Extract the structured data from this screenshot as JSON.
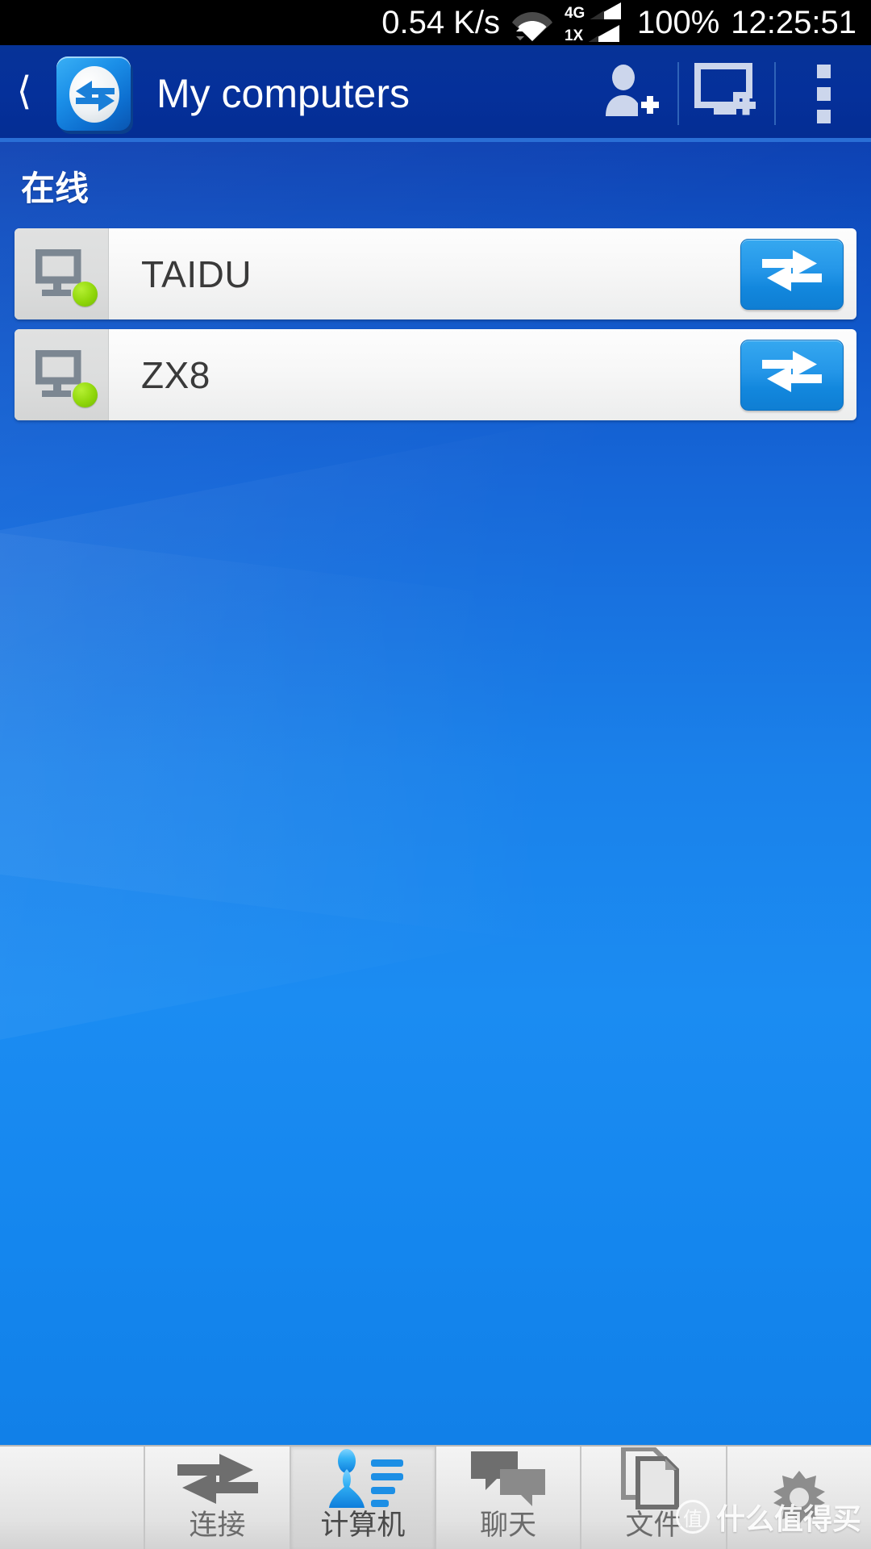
{
  "status_bar": {
    "network_speed": "0.54 K/s",
    "wifi_icon": "wifi-icon",
    "sim1_label": "4G",
    "sim2_label": "1X",
    "battery": "100%",
    "clock": "12:25:51",
    "background_color": "#000000",
    "text_color": "#ffffff"
  },
  "app_bar": {
    "back_icon": "back-chevron-icon",
    "logo_icon": "teamviewer-logo-icon",
    "title": "My computers",
    "actions": [
      {
        "name": "add-contact-button",
        "icon": "person-add-icon"
      },
      {
        "name": "add-computer-button",
        "icon": "monitor-add-icon"
      },
      {
        "name": "overflow-menu-button",
        "icon": "kebab-menu-icon"
      }
    ],
    "background_color": "#05309a",
    "title_color": "#ffffff"
  },
  "content": {
    "section_title": "在线",
    "background_color": "#1a81ea",
    "computers": [
      {
        "name": "TAIDU",
        "status": "online",
        "status_color": "#8fd60a",
        "device_icon": "monitor-icon",
        "connect_icon": "connect-arrows-icon"
      },
      {
        "name": "ZX8",
        "status": "online",
        "status_color": "#8fd60a",
        "device_icon": "monitor-icon",
        "connect_icon": "connect-arrows-icon"
      }
    ]
  },
  "tab_bar": {
    "active_index": 2,
    "tabs": [
      {
        "label": "",
        "icon": "",
        "name": "tab-empty"
      },
      {
        "label": "连接",
        "icon": "connect-arrows-icon",
        "name": "tab-connect"
      },
      {
        "label": "计算机",
        "icon": "computers-person-icon",
        "name": "tab-computers"
      },
      {
        "label": "聊天",
        "icon": "chat-bubbles-icon",
        "name": "tab-chat"
      },
      {
        "label": "文件",
        "icon": "files-documents-icon",
        "name": "tab-files"
      },
      {
        "label": "",
        "icon": "gear-icon",
        "name": "tab-settings"
      }
    ],
    "background_color": "#e2e2e2",
    "label_color": "#6b6b6b"
  },
  "watermark": {
    "badge": "值",
    "text": "什么值得买"
  }
}
